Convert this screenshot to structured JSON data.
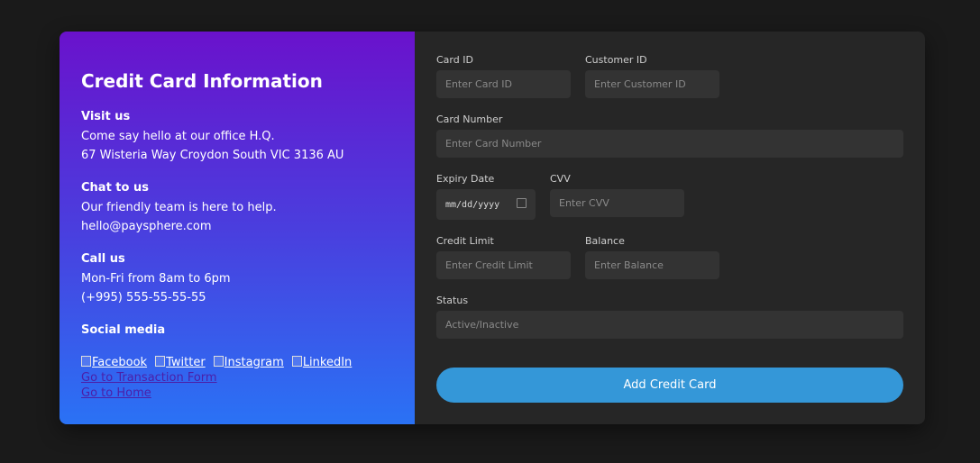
{
  "left": {
    "title": "Credit Card Information",
    "visit": {
      "heading": "Visit us",
      "line1": "Come say hello at our office H.Q.",
      "line2": "67 Wisteria Way Croydon South VIC 3136 AU"
    },
    "chat": {
      "heading": "Chat to us",
      "line1": "Our friendly team is here to help.",
      "line2": "hello@paysphere.com"
    },
    "call": {
      "heading": "Call us",
      "line1": "Mon-Fri from 8am to 6pm",
      "line2": "(+995) 555-55-55-55"
    },
    "social": {
      "heading": "Social media",
      "facebook": "Facebook",
      "twitter": "Twitter",
      "instagram": "Instagram",
      "linkedin": "LinkedIn"
    },
    "links": {
      "transaction": "Go to Transaction Form",
      "home": "Go to Home"
    }
  },
  "form": {
    "card_id": {
      "label": "Card ID",
      "placeholder": "Enter Card ID"
    },
    "customer_id": {
      "label": "Customer ID",
      "placeholder": "Enter Customer ID"
    },
    "card_number": {
      "label": "Card Number",
      "placeholder": "Enter Card Number"
    },
    "expiry": {
      "label": "Expiry Date",
      "value": "mm/dd/yyyy"
    },
    "cvv": {
      "label": "CVV",
      "placeholder": "Enter CVV"
    },
    "credit_limit": {
      "label": "Credit Limit",
      "placeholder": "Enter Credit Limit"
    },
    "balance": {
      "label": "Balance",
      "placeholder": "Enter Balance"
    },
    "status": {
      "label": "Status",
      "placeholder": "Active/Inactive"
    },
    "submit": "Add Credit Card"
  },
  "colors": {
    "background": "#1a1a1a",
    "panel": "#262626",
    "gradient_top": "#6a12cc",
    "gradient_bottom": "#2a72f5",
    "button": "#3497d8"
  }
}
